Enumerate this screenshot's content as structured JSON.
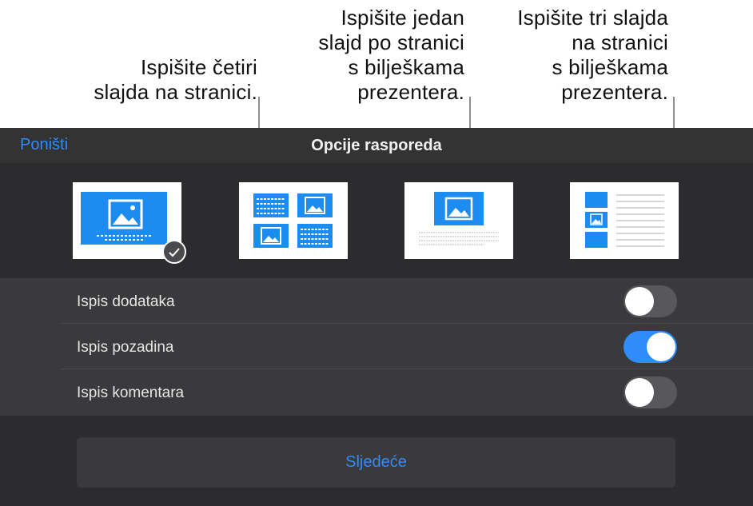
{
  "callouts": {
    "four_slides": "Ispišite četiri\nslajda na stranici.",
    "one_slide_notes": "Ispišite jedan\nslajd po stranici\ns bilješkama\nprezentera.",
    "three_slides_notes": "Ispišite tri slajda\nna stranici\ns bilješkama\nprezentera."
  },
  "header": {
    "cancel_label": "Poništi",
    "title": "Opcije rasporeda"
  },
  "layouts": {
    "selected_index": 0,
    "items": [
      "slide-icon",
      "four-slides-icon",
      "slide-with-notes-icon",
      "three-slides-with-notes-icon"
    ]
  },
  "options": [
    {
      "label": "Ispis dodataka",
      "on": false
    },
    {
      "label": "Ispis pozadina",
      "on": true
    },
    {
      "label": "Ispis komentara",
      "on": false
    }
  ],
  "footer": {
    "next_label": "Sljedeće"
  },
  "colors": {
    "accent": "#2f8cf8",
    "slide_blue": "#1c8cf0",
    "panel": "#3a3a3c",
    "panel_dark": "#2c2c2e"
  }
}
